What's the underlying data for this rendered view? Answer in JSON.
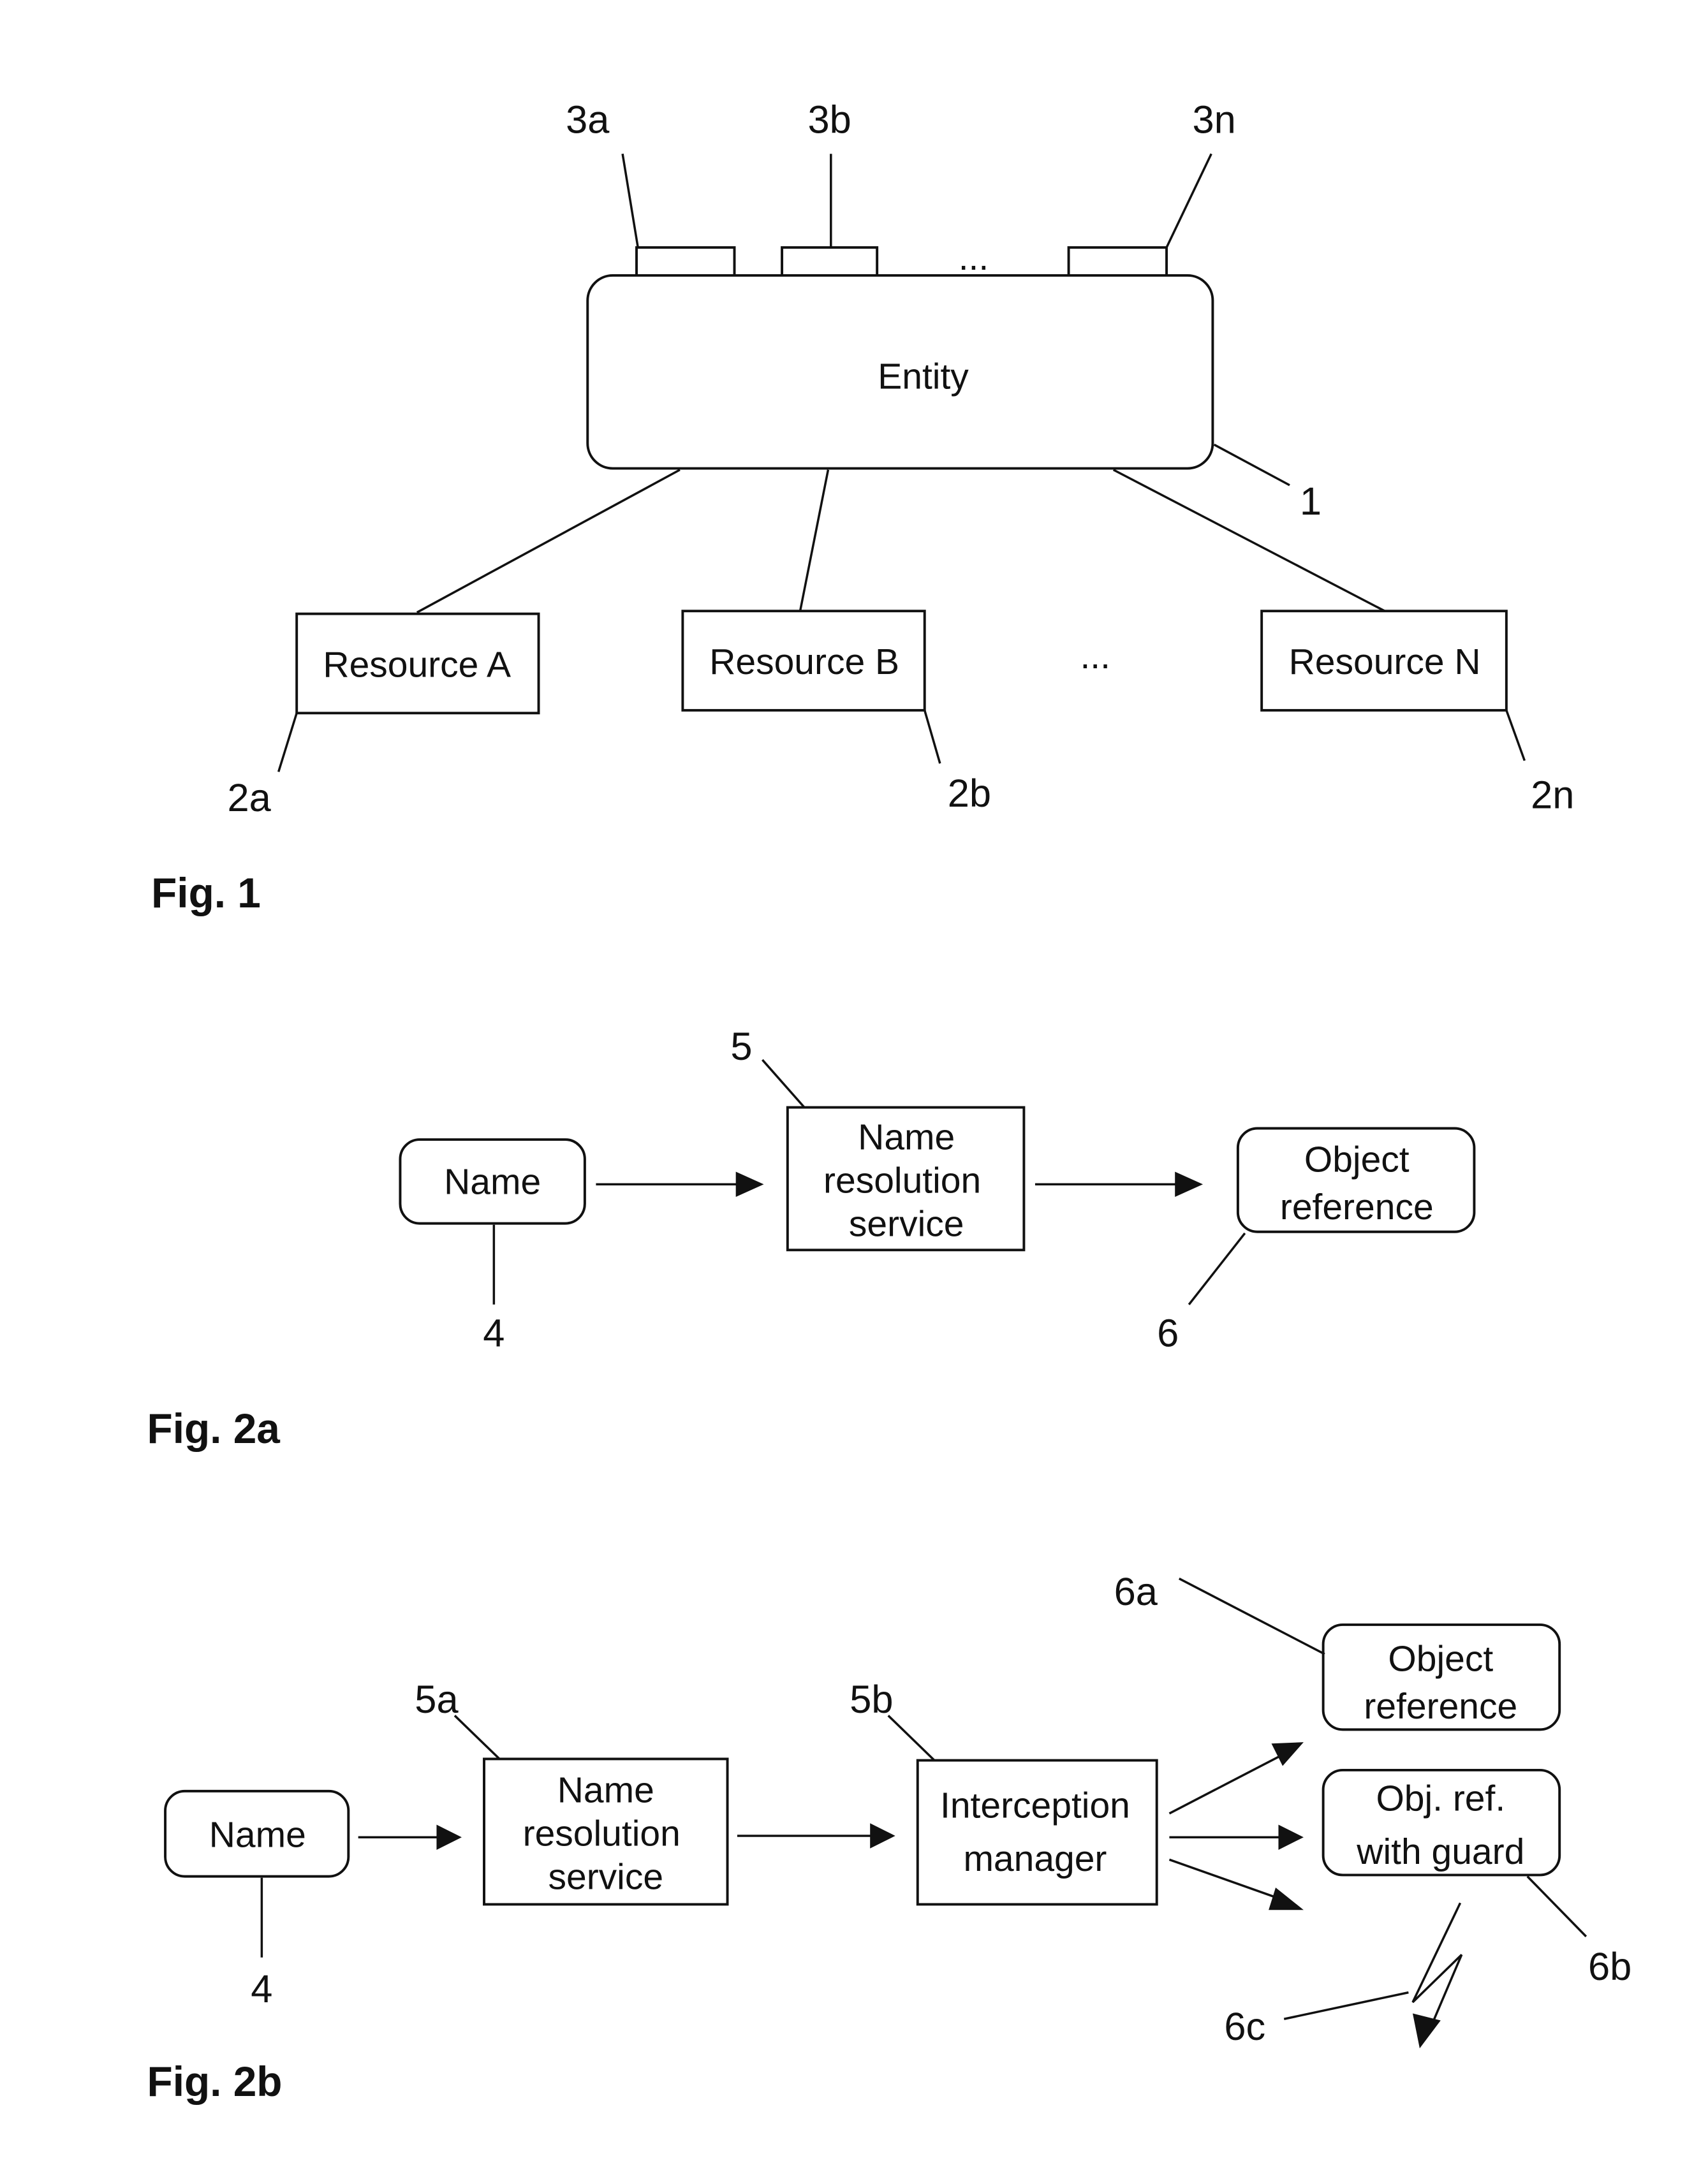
{
  "figures": {
    "fig1": {
      "caption": "Fig. 1",
      "entity": {
        "label": "Entity",
        "ref": "1"
      },
      "ports": [
        {
          "ref": "3a"
        },
        {
          "ref": "3b"
        },
        {
          "ref": "3n"
        }
      ],
      "ports_ellipsis": "...",
      "resources": [
        {
          "label": "Resource A",
          "ref": "2a"
        },
        {
          "label": "Resource B",
          "ref": "2b"
        },
        {
          "label": "Resource N",
          "ref": "2n"
        }
      ],
      "resources_ellipsis": "..."
    },
    "fig2a": {
      "caption": "Fig. 2a",
      "name_box": {
        "label": "Name",
        "ref": "4"
      },
      "service_box": {
        "lines": [
          "Name",
          "resolution",
          "service"
        ],
        "ref": "5"
      },
      "object_ref_box": {
        "lines": [
          "Object",
          "reference"
        ],
        "ref": "6"
      }
    },
    "fig2b": {
      "caption": "Fig. 2b",
      "name_box": {
        "label": "Name",
        "ref": "4"
      },
      "service_box": {
        "lines": [
          "Name",
          "resolution",
          "service"
        ],
        "ref": "5a"
      },
      "interception_box": {
        "lines": [
          "Interception",
          "manager"
        ],
        "ref": "5b"
      },
      "object_ref_box": {
        "lines": [
          "Object",
          "reference"
        ],
        "ref": "6a"
      },
      "guard_box": {
        "lines": [
          "Obj. ref.",
          "with guard"
        ],
        "ref": "6b"
      },
      "exception_ref": "6c"
    }
  }
}
